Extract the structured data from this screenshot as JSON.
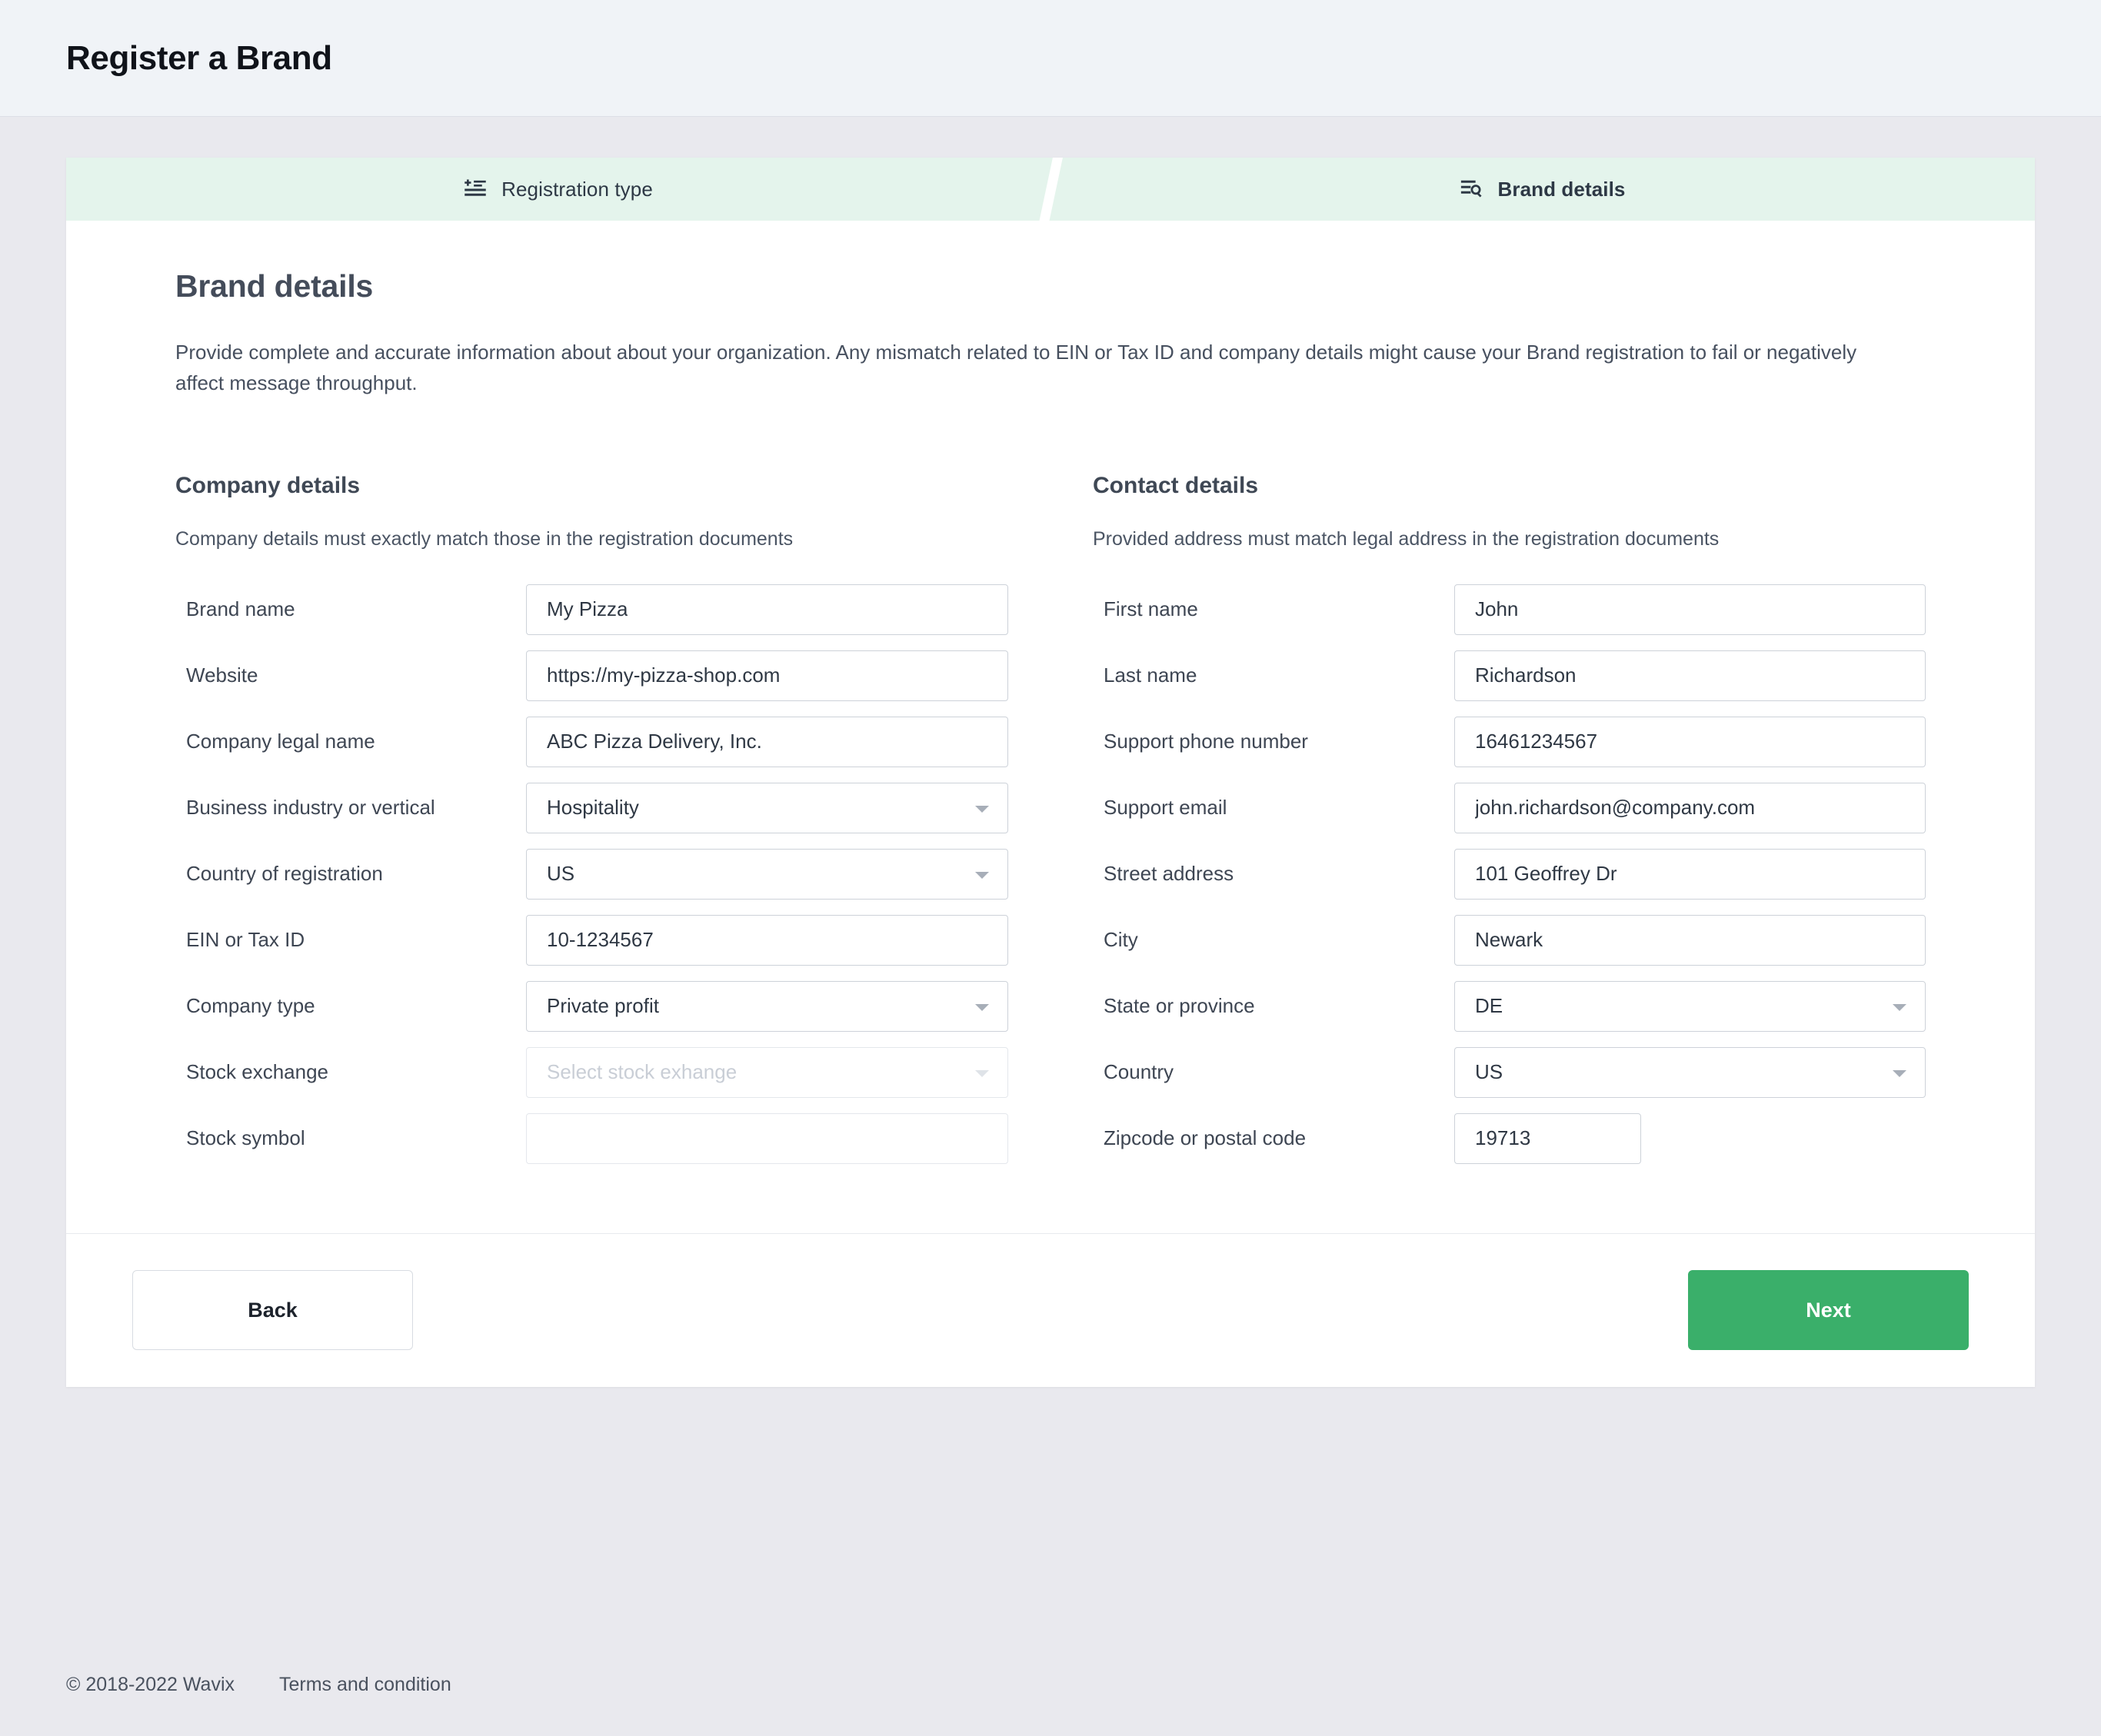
{
  "header": {
    "title": "Register a Brand"
  },
  "stepper": {
    "steps": [
      {
        "label": "Registration type",
        "icon": "list-add-icon",
        "active": false
      },
      {
        "label": "Brand details",
        "icon": "list-search-icon",
        "active": true
      }
    ]
  },
  "page": {
    "title": "Brand details",
    "intro": "Provide complete and accurate information about about your organization. Any mismatch related to EIN or Tax ID and company details might cause your Brand registration to fail or negatively affect message throughput."
  },
  "company": {
    "title": "Company details",
    "subtitle": "Company details must exactly match those in the registration documents",
    "fields": [
      {
        "label": "Brand name",
        "value": "My Pizza",
        "type": "text"
      },
      {
        "label": "Website",
        "value": "https://my-pizza-shop.com",
        "type": "text"
      },
      {
        "label": "Company legal name",
        "value": "ABC Pizza Delivery, Inc.",
        "type": "text"
      },
      {
        "label": "Business industry or vertical",
        "value": "Hospitality",
        "type": "select"
      },
      {
        "label": "Country of registration",
        "value": "US",
        "type": "select"
      },
      {
        "label": "EIN or Tax ID",
        "value": "10-1234567",
        "type": "text"
      },
      {
        "label": "Company type",
        "value": "Private profit",
        "type": "select"
      },
      {
        "label": "Stock exchange",
        "value": "",
        "placeholder": "Select stock exhange",
        "type": "select",
        "disabled": true
      },
      {
        "label": "Stock symbol",
        "value": "",
        "placeholder": "",
        "type": "text",
        "disabled": true
      }
    ]
  },
  "contact": {
    "title": "Contact details",
    "subtitle": "Provided address must match legal address in the registration documents",
    "fields": [
      {
        "label": "First name",
        "value": "John",
        "type": "text"
      },
      {
        "label": "Last name",
        "value": "Richardson",
        "type": "text"
      },
      {
        "label": "Support phone number",
        "value": "16461234567",
        "type": "text"
      },
      {
        "label": "Support email",
        "value": "john.richardson@company.com",
        "type": "text"
      },
      {
        "label": "Street address",
        "value": "101 Geoffrey Dr",
        "type": "text"
      },
      {
        "label": "City",
        "value": "Newark",
        "type": "text"
      },
      {
        "label": "State or province",
        "value": "DE",
        "type": "select"
      },
      {
        "label": "Country",
        "value": "US",
        "type": "select"
      },
      {
        "label": "Zipcode or postal code",
        "value": "19713",
        "type": "text",
        "narrow": true
      }
    ]
  },
  "actions": {
    "back_label": "Back",
    "next_label": "Next"
  },
  "footer": {
    "copyright": "© 2018-2022 Wavix",
    "terms_label": "Terms and condition"
  },
  "colors": {
    "accent_green": "#3aaf6a",
    "tab_bg": "#e4f4ec",
    "header_bg": "#f0f3f7",
    "page_bg": "#e9e9ee"
  }
}
